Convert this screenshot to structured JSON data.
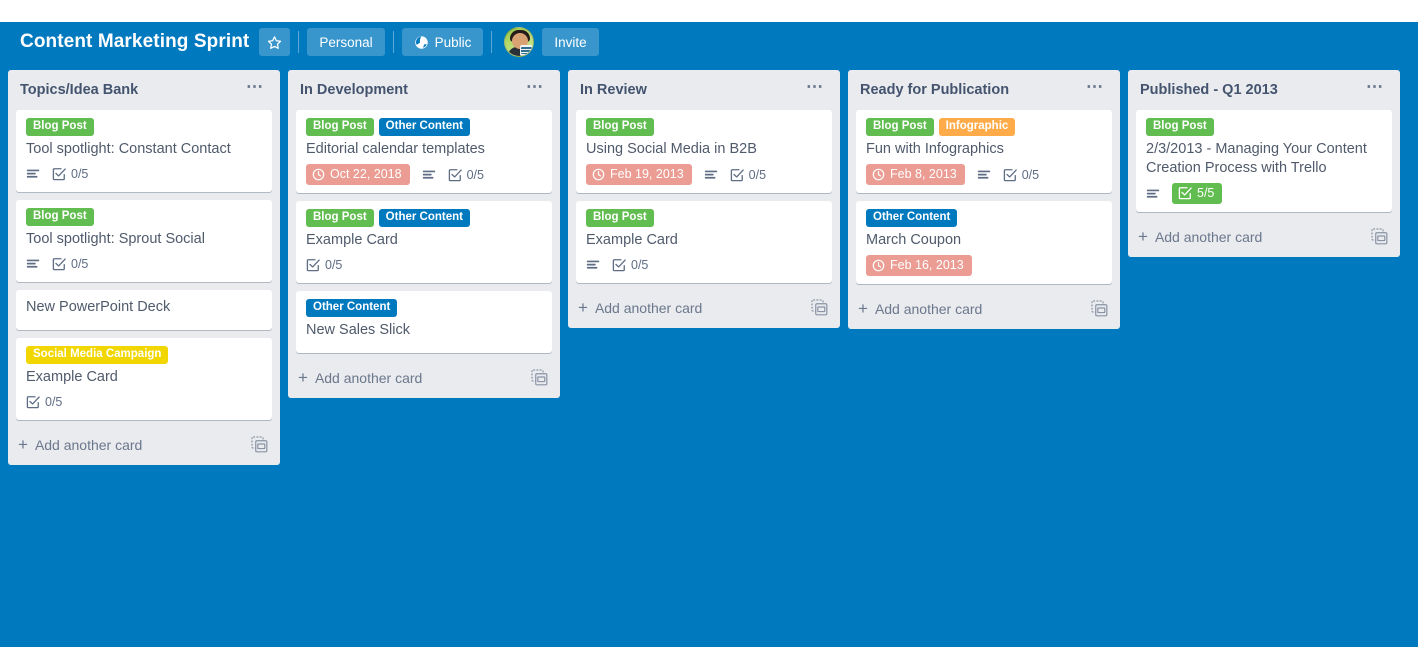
{
  "header": {
    "board_title": "Content Marketing Sprint",
    "star_icon": "star-outline-icon",
    "team_label": "Personal",
    "visibility_label": "Public",
    "visibility_icon": "globe-icon",
    "invite_label": "Invite",
    "avatar_name": "user-avatar"
  },
  "colors": {
    "board_background": "#0079bf",
    "header_background": "#0079bf",
    "list_background": "#e9ebee",
    "card_background": "#ffffff",
    "label_green": "#61bd4f",
    "label_blue": "#0079bf",
    "label_yellow": "#f2d600",
    "label_orange": "#ffab4a",
    "due_date_red": "#eb9c93",
    "checklist_complete_green": "#61bd4f",
    "text_muted": "#5e6c84"
  },
  "add_card_label": "Add another card",
  "add_card_template_icon": "card-template-icon",
  "list_menu_icon": "ellipsis-icon",
  "lists": [
    {
      "title": "Topics/Idea Bank",
      "cards": [
        {
          "title": "Tool spotlight: Constant Contact",
          "labels": [
            {
              "text": "Blog Post",
              "color": "#61bd4f"
            }
          ],
          "description": true,
          "checklist": "0/5",
          "checklist_done": false,
          "due": null
        },
        {
          "title": "Tool spotlight: Sprout Social",
          "labels": [
            {
              "text": "Blog Post",
              "color": "#61bd4f"
            }
          ],
          "description": true,
          "checklist": "0/5",
          "checklist_done": false,
          "due": null
        },
        {
          "title": "New PowerPoint Deck",
          "labels": [],
          "description": false,
          "checklist": null,
          "checklist_done": false,
          "due": null
        },
        {
          "title": "Example Card",
          "labels": [
            {
              "text": "Social Media Campaign",
              "color": "#f2d600"
            }
          ],
          "description": false,
          "checklist": "0/5",
          "checklist_done": false,
          "due": null
        }
      ]
    },
    {
      "title": "In Development",
      "cards": [
        {
          "title": "Editorial calendar templates",
          "labels": [
            {
              "text": "Blog Post",
              "color": "#61bd4f"
            },
            {
              "text": "Other Content",
              "color": "#0079bf"
            }
          ],
          "description": true,
          "checklist": "0/5",
          "checklist_done": false,
          "due": "Oct 22, 2018"
        },
        {
          "title": "Example Card",
          "labels": [
            {
              "text": "Blog Post",
              "color": "#61bd4f"
            },
            {
              "text": "Other Content",
              "color": "#0079bf"
            }
          ],
          "description": false,
          "checklist": "0/5",
          "checklist_done": false,
          "due": null
        },
        {
          "title": "New Sales Slick",
          "labels": [
            {
              "text": "Other Content",
              "color": "#0079bf"
            }
          ],
          "description": false,
          "checklist": null,
          "checklist_done": false,
          "due": null
        }
      ]
    },
    {
      "title": "In Review",
      "cards": [
        {
          "title": "Using Social Media in B2B",
          "labels": [
            {
              "text": "Blog Post",
              "color": "#61bd4f"
            }
          ],
          "description": true,
          "checklist": "0/5",
          "checklist_done": false,
          "due": "Feb 19, 2013"
        },
        {
          "title": "Example Card",
          "labels": [
            {
              "text": "Blog Post",
              "color": "#61bd4f"
            }
          ],
          "description": true,
          "checklist": "0/5",
          "checklist_done": false,
          "due": null
        }
      ]
    },
    {
      "title": "Ready for Publication",
      "cards": [
        {
          "title": "Fun with Infographics",
          "labels": [
            {
              "text": "Blog Post",
              "color": "#61bd4f"
            },
            {
              "text": "Infographic",
              "color": "#ffab4a"
            }
          ],
          "description": true,
          "checklist": "0/5",
          "checklist_done": false,
          "due": "Feb 8, 2013"
        },
        {
          "title": "March Coupon",
          "labels": [
            {
              "text": "Other Content",
              "color": "#0079bf"
            }
          ],
          "description": false,
          "checklist": null,
          "checklist_done": false,
          "due": "Feb 16, 2013"
        }
      ]
    },
    {
      "title": "Published - Q1 2013",
      "cards": [
        {
          "title": "2/3/2013 - Managing Your Content Creation Process with Trello",
          "labels": [
            {
              "text": "Blog Post",
              "color": "#61bd4f"
            }
          ],
          "description": true,
          "checklist": "5/5",
          "checklist_done": true,
          "due": null
        }
      ]
    }
  ]
}
